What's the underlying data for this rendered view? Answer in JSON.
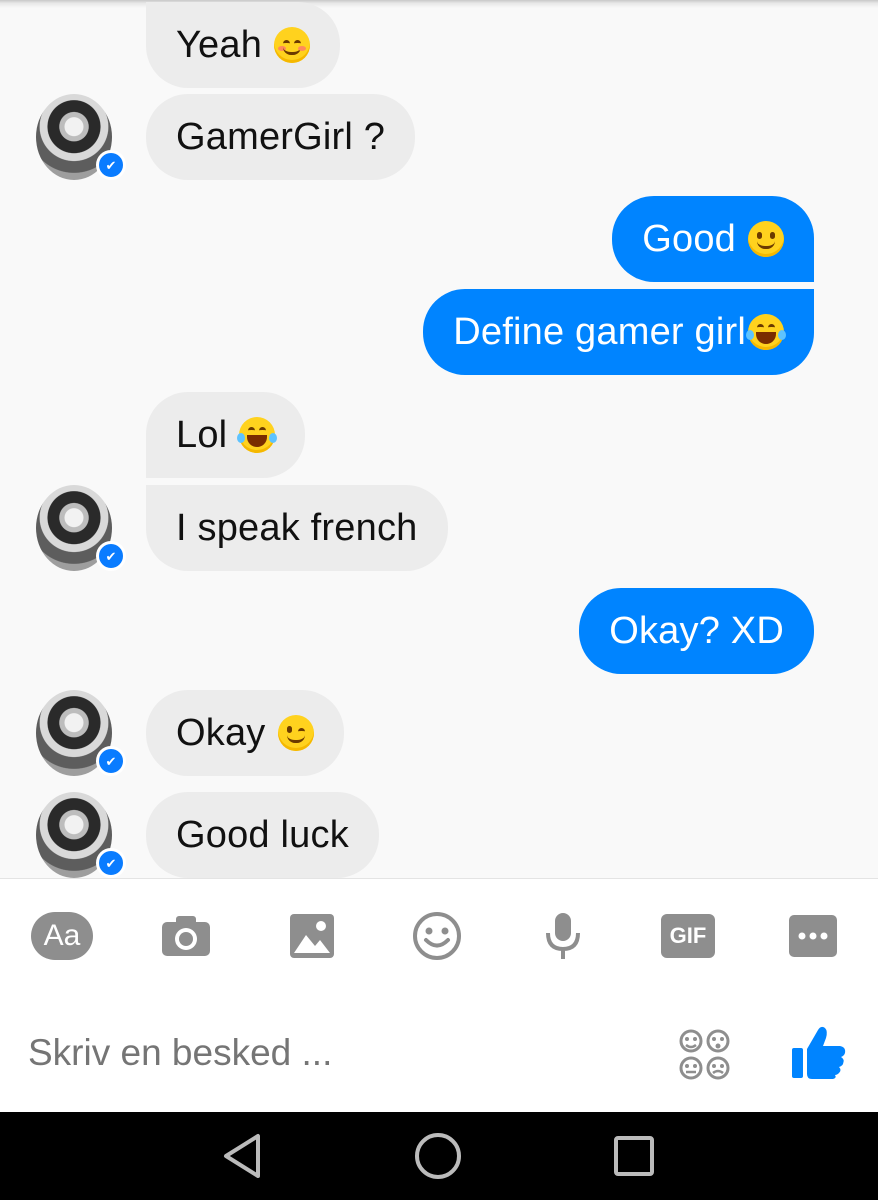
{
  "messages": [
    {
      "side": "in",
      "text": "Yeah",
      "emoji": "blush-icon"
    },
    {
      "side": "in",
      "text": "GamerGirl ?"
    },
    {
      "side": "out",
      "text": "Good",
      "emoji": "slight-smile-icon"
    },
    {
      "side": "out",
      "text": "Define gamer girl",
      "emoji": "laugh-tears-icon"
    },
    {
      "side": "in",
      "text": "Lol",
      "emoji": "laugh-tears-icon"
    },
    {
      "side": "in",
      "text": "I speak french"
    },
    {
      "side": "out",
      "text": "Okay? XD"
    },
    {
      "side": "in",
      "text": "Okay",
      "emoji": "wink-icon"
    },
    {
      "side": "in",
      "text": "Good luck"
    }
  ],
  "toolbar": {
    "aa_label": "Aa",
    "gif_label": "GIF",
    "icons": [
      "text-format-icon",
      "camera-icon",
      "image-icon",
      "emoji-icon",
      "microphone-icon",
      "gif-icon",
      "more-icon"
    ]
  },
  "composer": {
    "placeholder": "Skriv en besked ..."
  },
  "colors": {
    "outgoing": "#0084ff",
    "incoming": "#ececec",
    "icons": "#8e8e8e",
    "like": "#0084ff"
  },
  "navbar": {
    "icons": [
      "back-icon",
      "home-icon",
      "recents-icon"
    ]
  }
}
